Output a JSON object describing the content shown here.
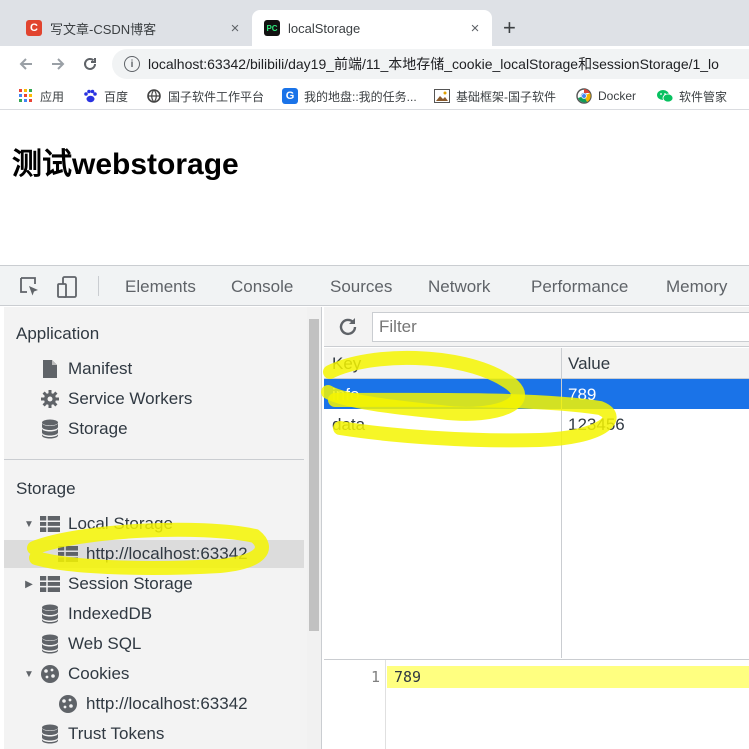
{
  "browser": {
    "tabs": [
      {
        "title": "写文章-CSDN博客",
        "favicon": "C",
        "active": false
      },
      {
        "title": "localStorage",
        "favicon": "PC",
        "active": true
      }
    ],
    "tab_close_glyph": "×",
    "new_tab_glyph": "+",
    "url": "localhost:63342/bilibili/day19_前端/11_本地存储_cookie_localStorage和sessionStorage/1_lo",
    "bookmarks": [
      {
        "label": "应用",
        "icon": "apps-grid-icon"
      },
      {
        "label": "百度",
        "icon": "baidu-paw-icon"
      },
      {
        "label": "国子软件工作平台",
        "icon": "globe-icon"
      },
      {
        "label": "我的地盘::我的任务...",
        "icon": "g-logo-icon"
      },
      {
        "label": "基础框架-国子软件",
        "icon": "photo-icon"
      },
      {
        "label": "Docker",
        "icon": "docker-icon"
      },
      {
        "label": "软件管家",
        "icon": "wechat-icon"
      }
    ]
  },
  "page": {
    "heading": "测试webstorage"
  },
  "devtools": {
    "tabs": [
      "Elements",
      "Console",
      "Sources",
      "Network",
      "Performance",
      "Memory"
    ],
    "sidebar": {
      "application_title": "Application",
      "application_items": [
        "Manifest",
        "Service Workers",
        "Storage"
      ],
      "storage_title": "Storage",
      "local_storage": "Local Storage",
      "local_storage_origin": "http://localhost:63342",
      "session_storage": "Session Storage",
      "indexeddb": "IndexedDB",
      "websql": "Web SQL",
      "cookies": "Cookies",
      "cookies_origin": "http://localhost:63342",
      "trust_tokens": "Trust Tokens"
    },
    "filter_placeholder": "Filter",
    "table": {
      "columns": [
        "Key",
        "Value"
      ],
      "rows": [
        {
          "key": "info",
          "value": "789"
        },
        {
          "key": "data",
          "value": "123456"
        }
      ]
    },
    "preview": {
      "line_number": "1",
      "text": "789"
    }
  },
  "colors": {
    "selection": "#1a73e8",
    "highlighter": "#f5f500",
    "preview_line": "#ffff80"
  }
}
